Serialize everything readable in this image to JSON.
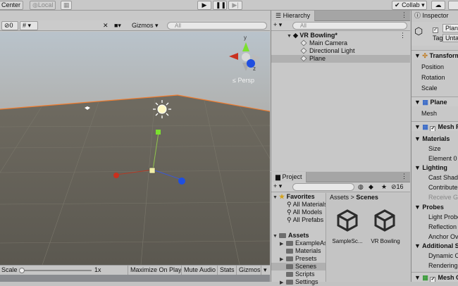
{
  "toolbar": {
    "pivot": "Center",
    "space": "Local",
    "collab": "Collab",
    "play_icon": "play-icon",
    "pause_icon": "pause-icon",
    "step_icon": "step-icon"
  },
  "scene": {
    "hidden_count": "0",
    "gizmos_label": "Gizmos",
    "search_placeholder": "All",
    "persp_label": "Persp",
    "gizmo_axes": {
      "y": "y",
      "z": "z"
    },
    "status": {
      "scale_label": "Scale",
      "scale_value": "1x",
      "maximize": "Maximize On Play",
      "mute": "Mute Audio",
      "stats": "Stats",
      "gizmos": "Gizmos"
    }
  },
  "hierarchy": {
    "tab": "Hierarchy",
    "search_placeholder": "All",
    "scene_name": "VR Bowling*",
    "items": [
      "Main Camera",
      "Directional Light",
      "Plane"
    ],
    "selected": "Plane"
  },
  "project": {
    "tab": "Project",
    "hidden_count": "16",
    "favorites_label": "Favorites",
    "favorites": [
      "All Materials",
      "All Models",
      "All Prefabs"
    ],
    "assets_label": "Assets",
    "folders": [
      "ExampleAss",
      "Materials",
      "Presets",
      "Scenes",
      "Scripts",
      "Settings"
    ],
    "selected_folder": "Scenes",
    "breadcrumb": {
      "root": "Assets",
      "separator": ">",
      "current": "Scenes"
    },
    "files": [
      "SampleSc...",
      "VR Bowling"
    ]
  },
  "inspector": {
    "tab": "Inspector",
    "object_name": "Plane",
    "tag_label": "Tag",
    "tag_value": "Untagged",
    "transform_label": "Transform",
    "transform_fields": [
      "Position",
      "Rotation",
      "Scale"
    ],
    "mesh_filter_label": "Plane",
    "mesh_label": "Mesh",
    "renderer_label": "Mesh Renderer",
    "materials_label": "Materials",
    "materials_fields": [
      "Size",
      "Element 0"
    ],
    "lighting_label": "Lighting",
    "lighting_fields": [
      "Cast Shadows",
      "Contribute GI",
      "Receive GI"
    ],
    "probes_label": "Probes",
    "probes_fields": [
      "Light Probes",
      "Reflection Probes",
      "Anchor Override"
    ],
    "additional_label": "Additional Settings",
    "additional_fields": [
      "Dynamic Occlusion",
      "Rendering Layer Mask"
    ],
    "collider_label": "Mesh Collider"
  }
}
